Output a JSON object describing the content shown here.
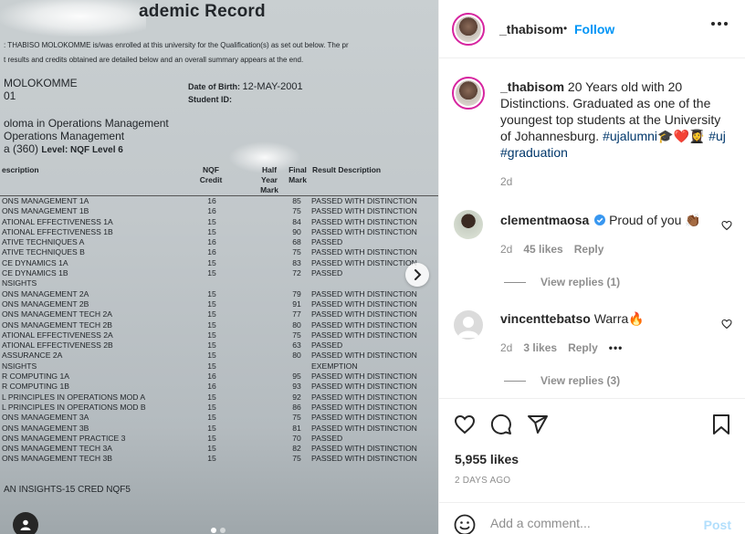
{
  "document": {
    "title": "ademic Record",
    "intro_line1": ": THABISO MOLOKOMME    is/was enrolled at this university for the Qualification(s) as set out below. The pr",
    "intro_line2": "t results and credits obtained are detailed below and an overall summary appears at the end.",
    "name_line1": "MOLOKOMME",
    "name_line2": "01",
    "dob_label": "Date of Birth:",
    "dob_value": "12-MAY-2001",
    "student_id_label": "Student ID:",
    "qual_line1": "oloma in Operations Management",
    "qual_line2": "Operations Management",
    "qual_line3": "a (360)",
    "qual_level": "Level: NQF Level 6",
    "headers": {
      "description": "escription",
      "nqf": "NQF\nCredit",
      "half_year": "Half\nYear\nMark",
      "final": "Final\nMark",
      "result": "Result Description"
    },
    "rows": [
      {
        "name": "ONS MANAGEMENT 1A",
        "credit": "16",
        "mark": "85",
        "result": "PASSED WITH DISTINCTION"
      },
      {
        "name": "ONS MANAGEMENT 1B",
        "credit": "16",
        "mark": "75",
        "result": "PASSED WITH DISTINCTION"
      },
      {
        "name": "ATIONAL EFFECTIVENESS 1A",
        "credit": "15",
        "mark": "84",
        "result": "PASSED WITH DISTINCTION"
      },
      {
        "name": "ATIONAL EFFECTIVENESS 1B",
        "credit": "15",
        "mark": "90",
        "result": "PASSED WITH DISTINCTION"
      },
      {
        "name": "ATIVE TECHNIQUES A",
        "credit": "16",
        "mark": "68",
        "result": "PASSED"
      },
      {
        "name": "ATIVE TECHNIQUES B",
        "credit": "16",
        "mark": "75",
        "result": "PASSED WITH DISTINCTION"
      },
      {
        "name": "CE DYNAMICS 1A",
        "credit": "15",
        "mark": "83",
        "result": "PASSED WITH DISTINCTION"
      },
      {
        "name": "CE DYNAMICS 1B",
        "credit": "15",
        "mark": "72",
        "result": "PASSED"
      },
      {
        "name": "NSIGHTS",
        "credit": "",
        "mark": "",
        "result": ""
      },
      {
        "name": "ONS MANAGEMENT 2A",
        "credit": "15",
        "mark": "79",
        "result": "PASSED WITH DISTINCTION"
      },
      {
        "name": "ONS MANAGEMENT 2B",
        "credit": "15",
        "mark": "91",
        "result": "PASSED WITH DISTINCTION"
      },
      {
        "name": "ONS MANAGEMENT TECH 2A",
        "credit": "15",
        "mark": "77",
        "result": "PASSED WITH DISTINCTION"
      },
      {
        "name": "ONS MANAGEMENT TECH 2B",
        "credit": "15",
        "mark": "80",
        "result": "PASSED WITH DISTINCTION"
      },
      {
        "name": "ATIONAL EFFECTIVENESS 2A",
        "credit": "15",
        "mark": "75",
        "result": "PASSED WITH DISTINCTION"
      },
      {
        "name": "ATIONAL EFFECTIVENESS 2B",
        "credit": "15",
        "mark": "63",
        "result": "PASSED"
      },
      {
        "name": "ASSURANCE 2A",
        "credit": "15",
        "mark": "80",
        "result": "PASSED WITH DISTINCTION"
      },
      {
        "name": "NSIGHTS",
        "credit": "15",
        "mark": "",
        "result": "EXEMPTION"
      },
      {
        "name": "R COMPUTING 1A",
        "credit": "16",
        "mark": "95",
        "result": "PASSED WITH DISTINCTION"
      },
      {
        "name": "R COMPUTING 1B",
        "credit": "16",
        "mark": "93",
        "result": "PASSED WITH DISTINCTION"
      },
      {
        "name": "L PRINCIPLES IN OPERATIONS MOD A",
        "credit": "15",
        "mark": "92",
        "result": "PASSED WITH DISTINCTION"
      },
      {
        "name": "L PRINCIPLES IN OPERATIONS MOD B",
        "credit": "15",
        "mark": "86",
        "result": "PASSED WITH DISTINCTION"
      },
      {
        "name": "ONS MANAGEMENT 3A",
        "credit": "15",
        "mark": "75",
        "result": "PASSED WITH DISTINCTION"
      },
      {
        "name": "ONS MANAGEMENT 3B",
        "credit": "15",
        "mark": "81",
        "result": "PASSED WITH DISTINCTION"
      },
      {
        "name": "ONS MANAGEMENT PRACTICE 3",
        "credit": "15",
        "mark": "70",
        "result": "PASSED"
      },
      {
        "name": "ONS MANAGEMENT TECH 3A",
        "credit": "15",
        "mark": "82",
        "result": "PASSED WITH DISTINCTION"
      },
      {
        "name": "ONS MANAGEMENT TECH 3B",
        "credit": "15",
        "mark": "75",
        "result": "PASSED WITH DISTINCTION"
      }
    ],
    "footer": "AN INSIGHTS-15 CRED NQF5"
  },
  "header": {
    "username": "_thabisom",
    "separator": "•",
    "follow_label": "Follow"
  },
  "caption": {
    "username": "_thabisom",
    "text": " 20 Years old with 20 Distinctions. Graduated as one of the youngest top students at the University of Johannesburg. ",
    "hashtag1": "#ujalumni",
    "emojis": "🎓❤️👩‍🎓",
    "hashtag2": "#uj",
    "hashtag3": "#graduation",
    "time": "2d"
  },
  "comments": [
    {
      "username": "clementmaosa",
      "verified": true,
      "text": "Proud of you 👏🏾",
      "time": "2d",
      "likes": "45 likes",
      "reply_label": "Reply",
      "view_replies": "View replies (1)"
    },
    {
      "username": "vincenttebatso",
      "verified": false,
      "text": "Warra🔥",
      "time": "2d",
      "likes": "3 likes",
      "reply_label": "Reply",
      "more": "•••",
      "view_replies": "View replies (3)"
    }
  ],
  "post": {
    "likes": "5,955 likes",
    "date": "2 DAYS AGO"
  },
  "add_comment": {
    "placeholder": "Add a comment...",
    "post_label": "Post"
  },
  "colors": {
    "accent": "#0095f6",
    "hashtag": "#00376b",
    "muted": "#8e8e8e",
    "verified": "#3897f0",
    "post_disabled": "#b2dffc"
  }
}
